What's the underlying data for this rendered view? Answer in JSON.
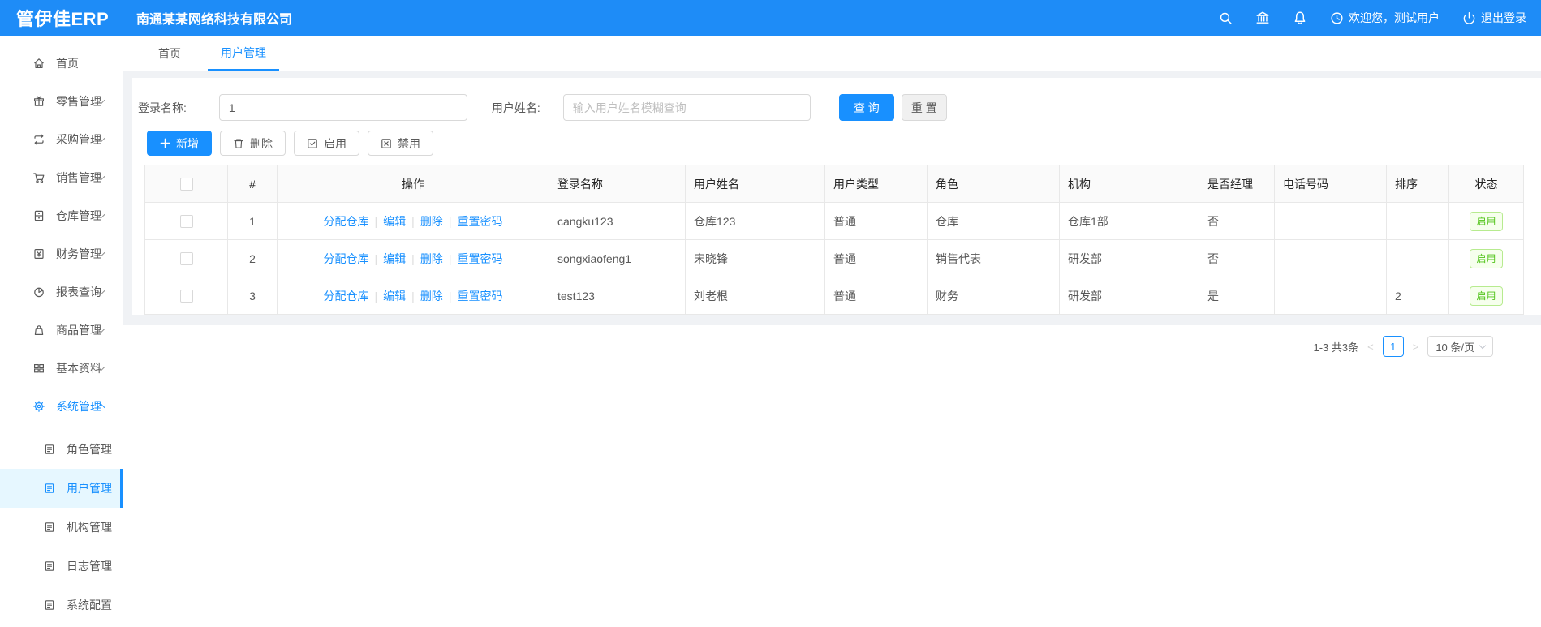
{
  "header": {
    "logo": "管伊佳ERP",
    "company": "南通某某网络科技有限公司",
    "welcome": "欢迎您，测试用户",
    "logout": "退出登录",
    "accent_color": "#1e8cf7"
  },
  "sidebar": {
    "items": [
      {
        "label": "首页",
        "icon": "home-icon",
        "expandable": false
      },
      {
        "label": "零售管理",
        "icon": "retail-icon",
        "expandable": true
      },
      {
        "label": "采购管理",
        "icon": "purchase-icon",
        "expandable": true
      },
      {
        "label": "销售管理",
        "icon": "sales-icon",
        "expandable": true
      },
      {
        "label": "仓库管理",
        "icon": "warehouse-icon",
        "expandable": true
      },
      {
        "label": "财务管理",
        "icon": "finance-icon",
        "expandable": true
      },
      {
        "label": "报表查询",
        "icon": "report-icon",
        "expandable": true
      },
      {
        "label": "商品管理",
        "icon": "goods-icon",
        "expandable": true
      },
      {
        "label": "基本资料",
        "icon": "basedata-icon",
        "expandable": true
      },
      {
        "label": "系统管理",
        "icon": "system-icon",
        "expandable": true,
        "expanded": true
      }
    ],
    "sub_items": [
      {
        "label": "角色管理",
        "active": false
      },
      {
        "label": "用户管理",
        "active": true
      },
      {
        "label": "机构管理",
        "active": false
      },
      {
        "label": "日志管理",
        "active": false
      },
      {
        "label": "系统配置",
        "active": false
      }
    ]
  },
  "tabs": [
    {
      "label": "首页",
      "active": false
    },
    {
      "label": "用户管理",
      "active": true
    }
  ],
  "search": {
    "login_label": "登录名称:",
    "login_value": "1",
    "name_label": "用户姓名:",
    "name_placeholder": "输入用户姓名模糊查询",
    "query_btn": "查 询",
    "reset_btn": "重 置"
  },
  "toolbar": {
    "add": "新增",
    "delete": "删除",
    "enable": "启用",
    "disable": "禁用"
  },
  "table": {
    "headers": [
      "#",
      "操作",
      "登录名称",
      "用户姓名",
      "用户类型",
      "角色",
      "机构",
      "是否经理",
      "电话号码",
      "排序",
      "状态"
    ],
    "op_links": [
      "分配仓库",
      "编辑",
      "删除",
      "重置密码"
    ],
    "rows": [
      {
        "index": "1",
        "login": "cangku123",
        "name": "仓库123",
        "type": "普通",
        "role": "仓库",
        "org": "仓库1部",
        "manager": "否",
        "phone": "",
        "sort": "",
        "status": "启用"
      },
      {
        "index": "2",
        "login": "songxiaofeng1",
        "name": "宋晓锋",
        "type": "普通",
        "role": "销售代表",
        "org": "研发部",
        "manager": "否",
        "phone": "",
        "sort": "",
        "status": "启用"
      },
      {
        "index": "3",
        "login": "test123",
        "name": "刘老根",
        "type": "普通",
        "role": "财务",
        "org": "研发部",
        "manager": "是",
        "phone": "",
        "sort": "2",
        "status": "启用"
      }
    ],
    "status_color": "#52c41a"
  },
  "pagination": {
    "total": "1-3 共3条",
    "page": "1",
    "page_size": "10 条/页"
  }
}
